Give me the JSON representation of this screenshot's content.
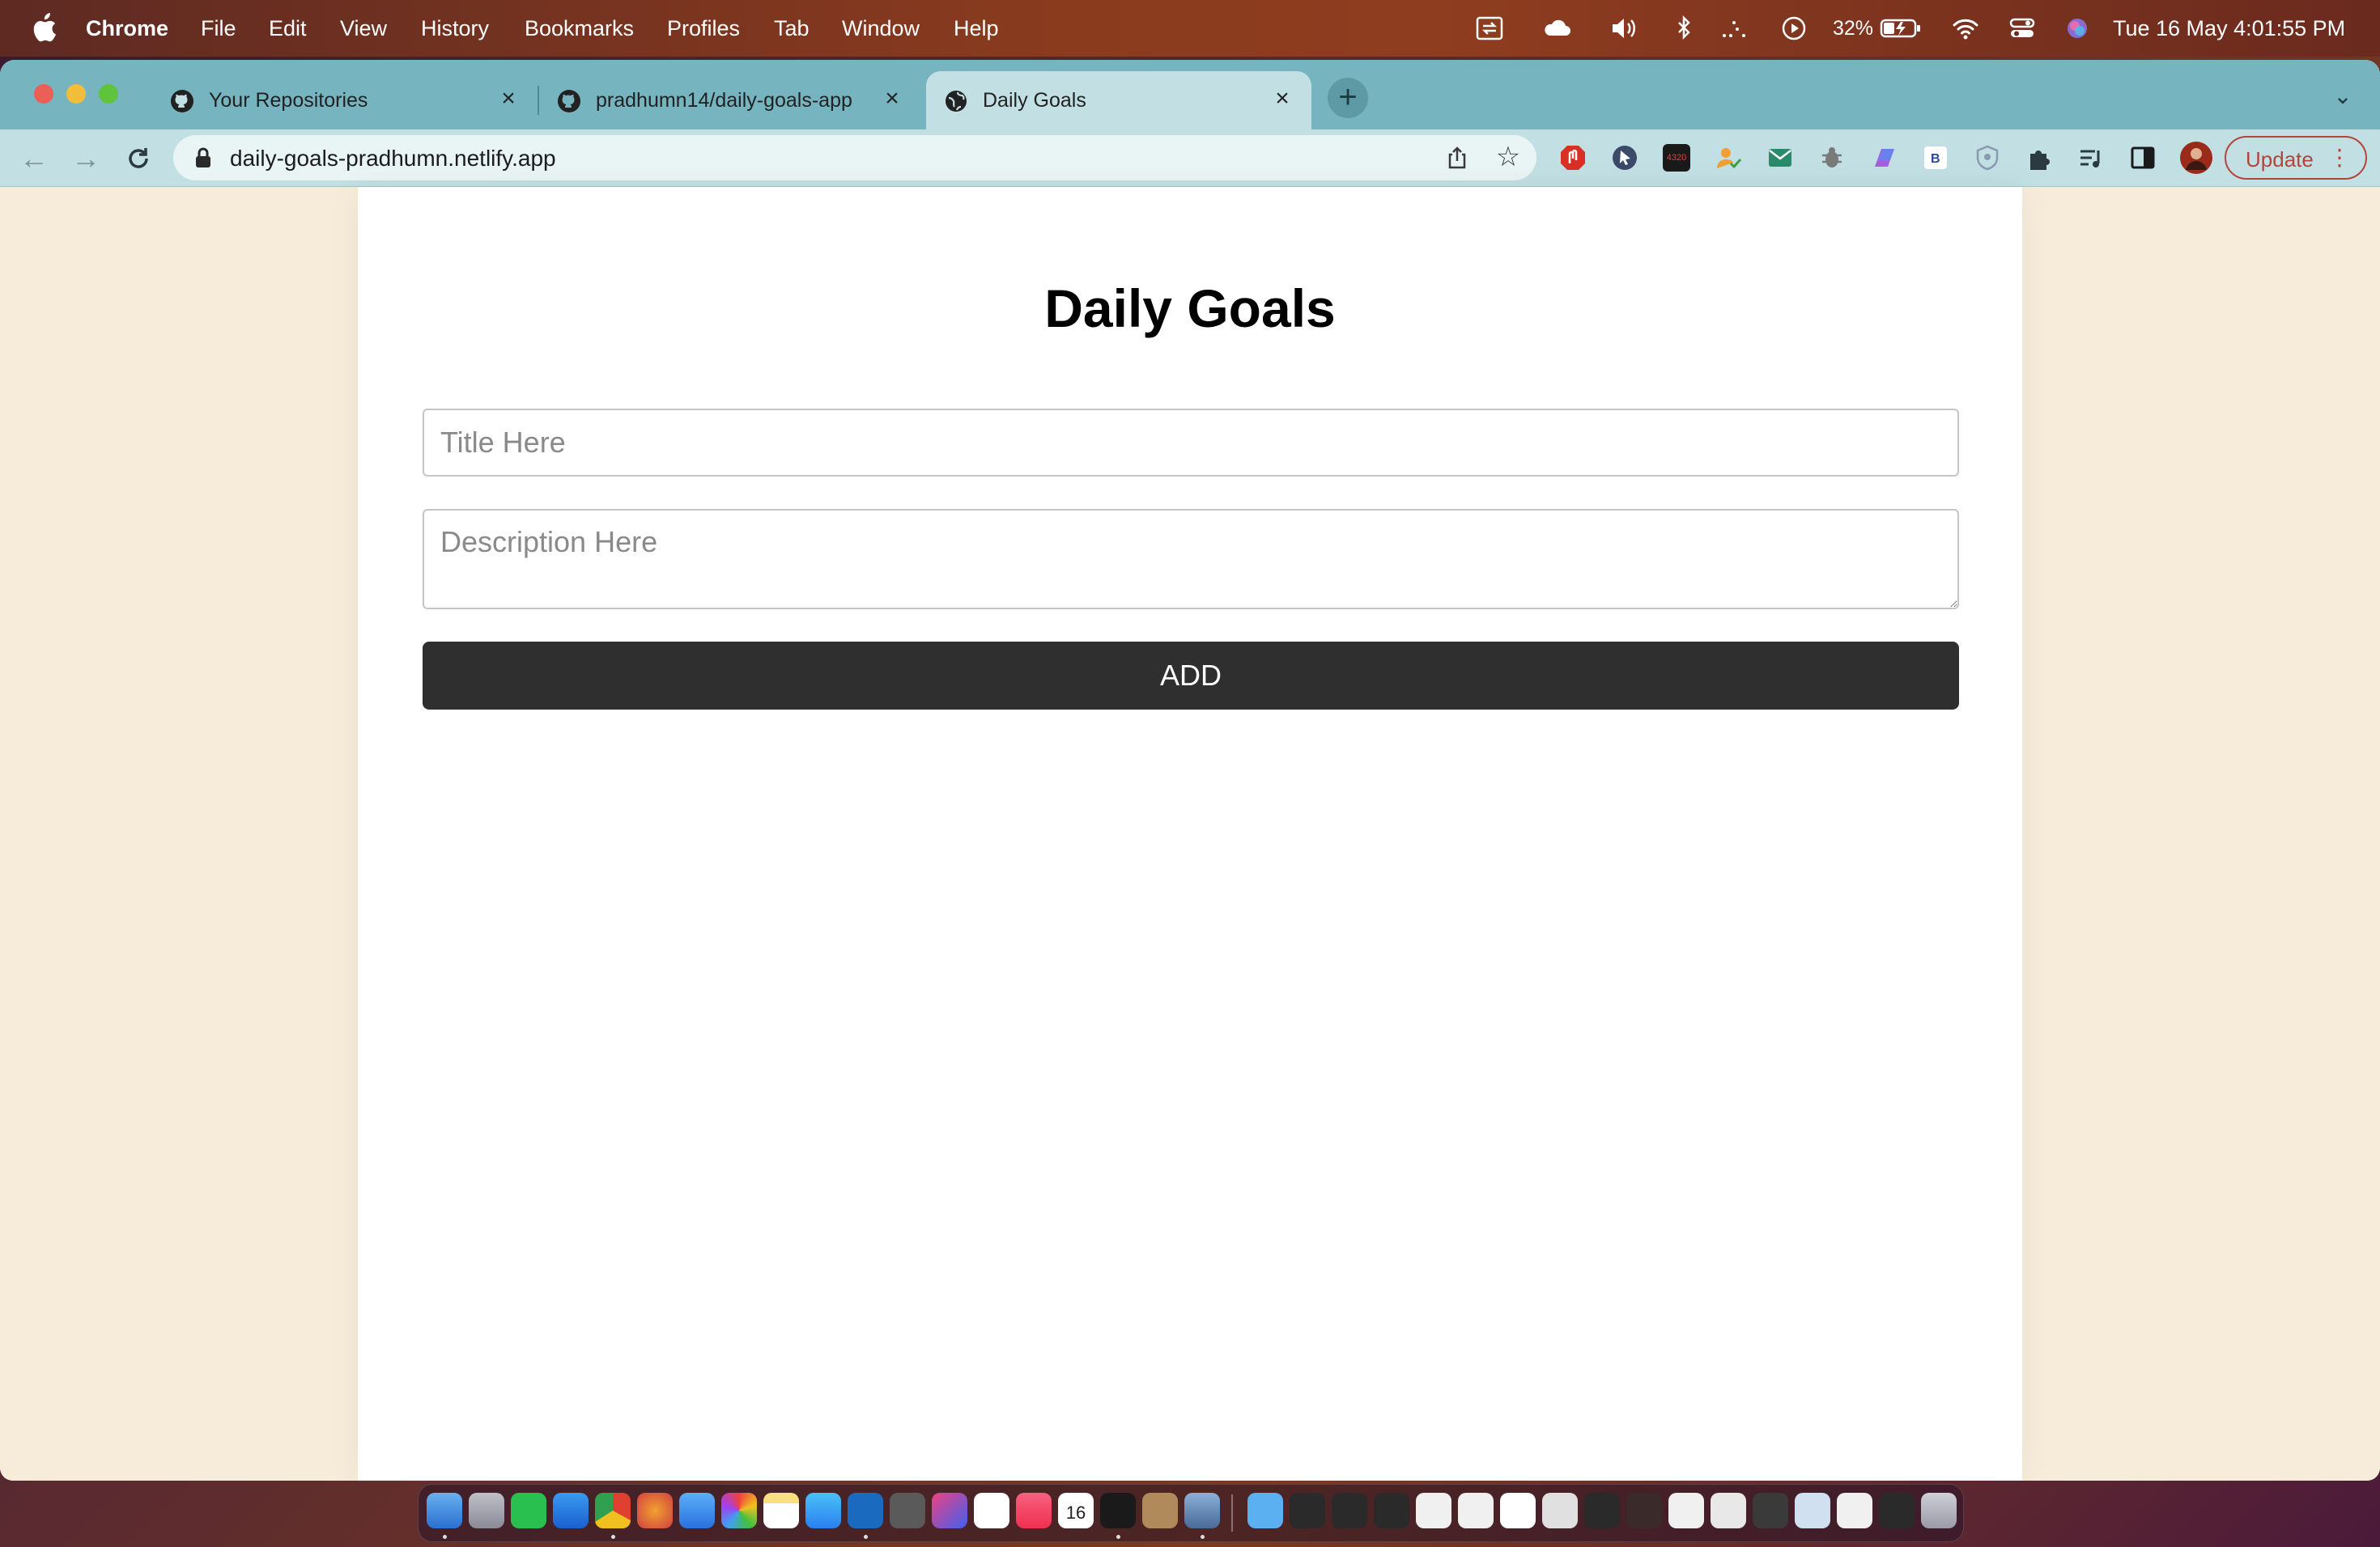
{
  "menubar": {
    "app": "Chrome",
    "items": [
      "File",
      "Edit",
      "View",
      "History",
      "Bookmarks",
      "Profiles",
      "Tab",
      "Window",
      "Help"
    ],
    "battery": "32%",
    "datetime": "Tue 16 May  4:01:55 PM"
  },
  "browser": {
    "tabs": [
      {
        "title": "Your Repositories",
        "icon": "github-icon"
      },
      {
        "title": "pradhumn14/daily-goals-app",
        "icon": "github-icon"
      },
      {
        "title": "Daily Goals",
        "icon": "globe-icon",
        "active": true
      }
    ],
    "url": "daily-goals-pradhumn.netlify.app",
    "update_label": "Update",
    "ext_badge": "4320"
  },
  "page": {
    "title": "Daily Goals",
    "title_placeholder": "Title Here",
    "title_value": "",
    "description_placeholder": "Description Here",
    "description_value": "",
    "add_label": "ADD"
  },
  "dock": {
    "calendar_day": "16"
  },
  "colors": {
    "page_bg": "#f7ebd9",
    "card_bg": "#ffffff",
    "button_bg": "#2f2f2f",
    "tabstrip": "#76b4c0",
    "toolbar": "#c2e0e4",
    "update_accent": "#b3443a"
  }
}
